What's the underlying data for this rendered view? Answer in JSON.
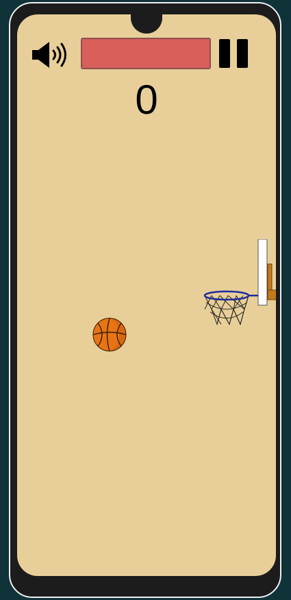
{
  "hud": {
    "sound_icon": "speaker-on-icon",
    "pause_icon": "pause-icon",
    "score": "0",
    "timer_fraction": 1.0
  },
  "colors": {
    "screen_bg": "#e8cf99",
    "timer_bar": "#d95f5b",
    "ball": "#e87515",
    "rim": "#1c2aa0",
    "backboard": "#ffffff",
    "pole": "#c57a1c"
  }
}
